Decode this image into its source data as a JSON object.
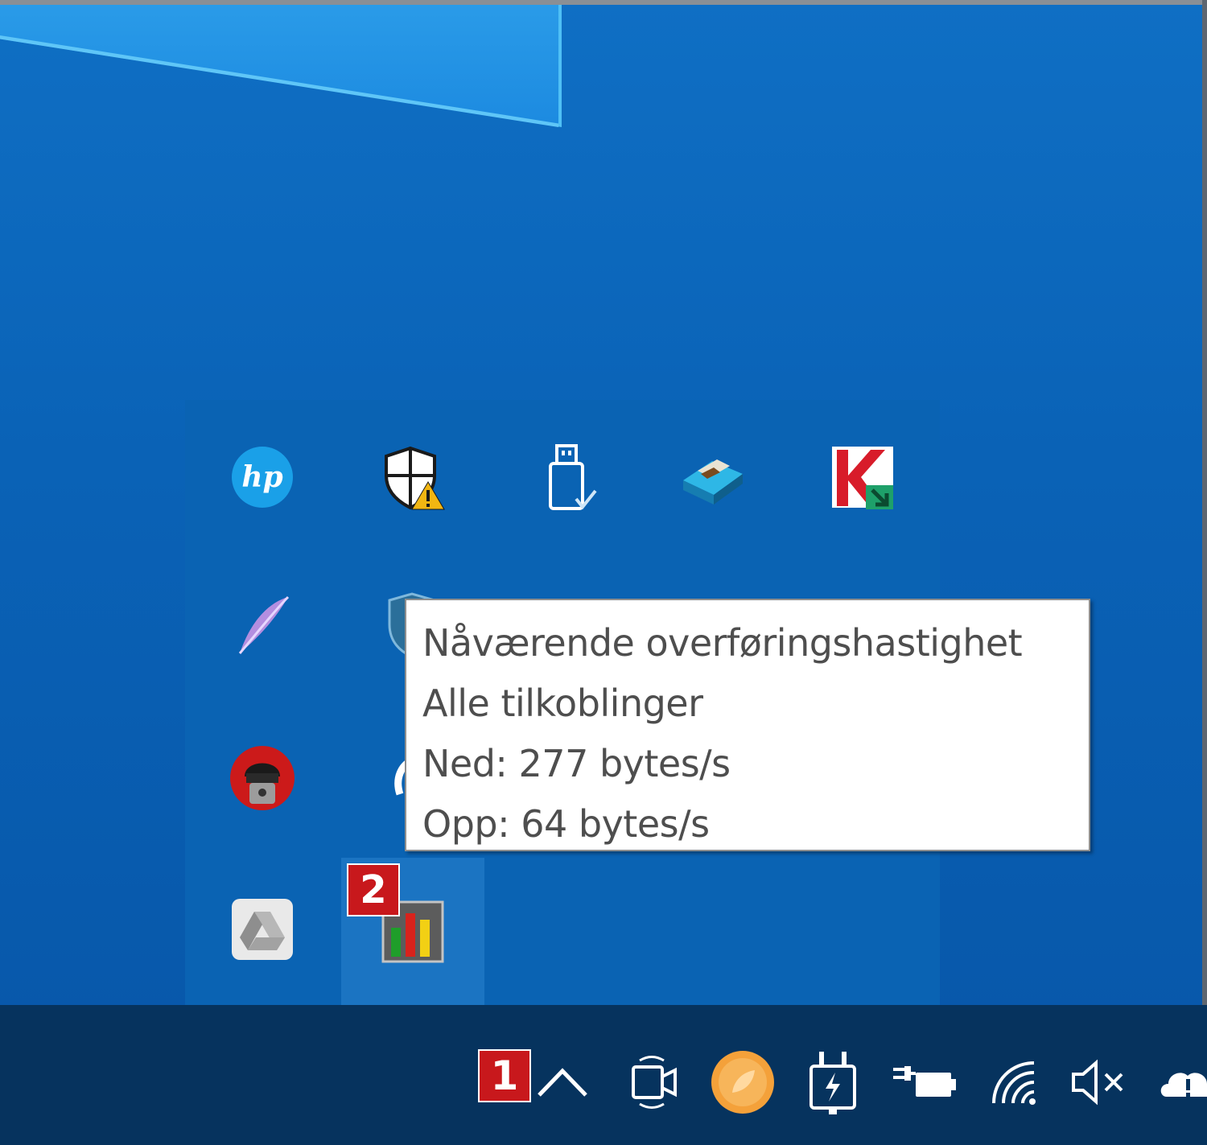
{
  "tooltip": {
    "lines": [
      "Nåværende overføringshastighet",
      "Alle tilkoblinger",
      "Ned: 277 bytes/s",
      "Opp: 64 bytes/s"
    ]
  },
  "badges": {
    "badge_1": "1",
    "badge_2": "2"
  },
  "tray_overflow_icons": [
    "hp-icon",
    "security-shield-warning-icon",
    "usb-eject-icon",
    "printer-scanner-icon",
    "kaspersky-icon",
    "feather-pen-icon",
    "shield-vpn-icon",
    "spy-agent-icon",
    "steam-like-icon",
    "google-drive-icon",
    "network-meter-icon"
  ],
  "taskbar_icons": [
    "show-hidden-icons-chevron",
    "meet-now-camera-icon",
    "orange-app-icon",
    "usb-power-icon",
    "battery-charging-icon",
    "wifi-icon",
    "volume-muted-icon",
    "onedrive-cloud-icon"
  ],
  "colors": {
    "desktop": "#0a62b6",
    "taskbar": "#06335e",
    "badge": "#c8181c"
  }
}
